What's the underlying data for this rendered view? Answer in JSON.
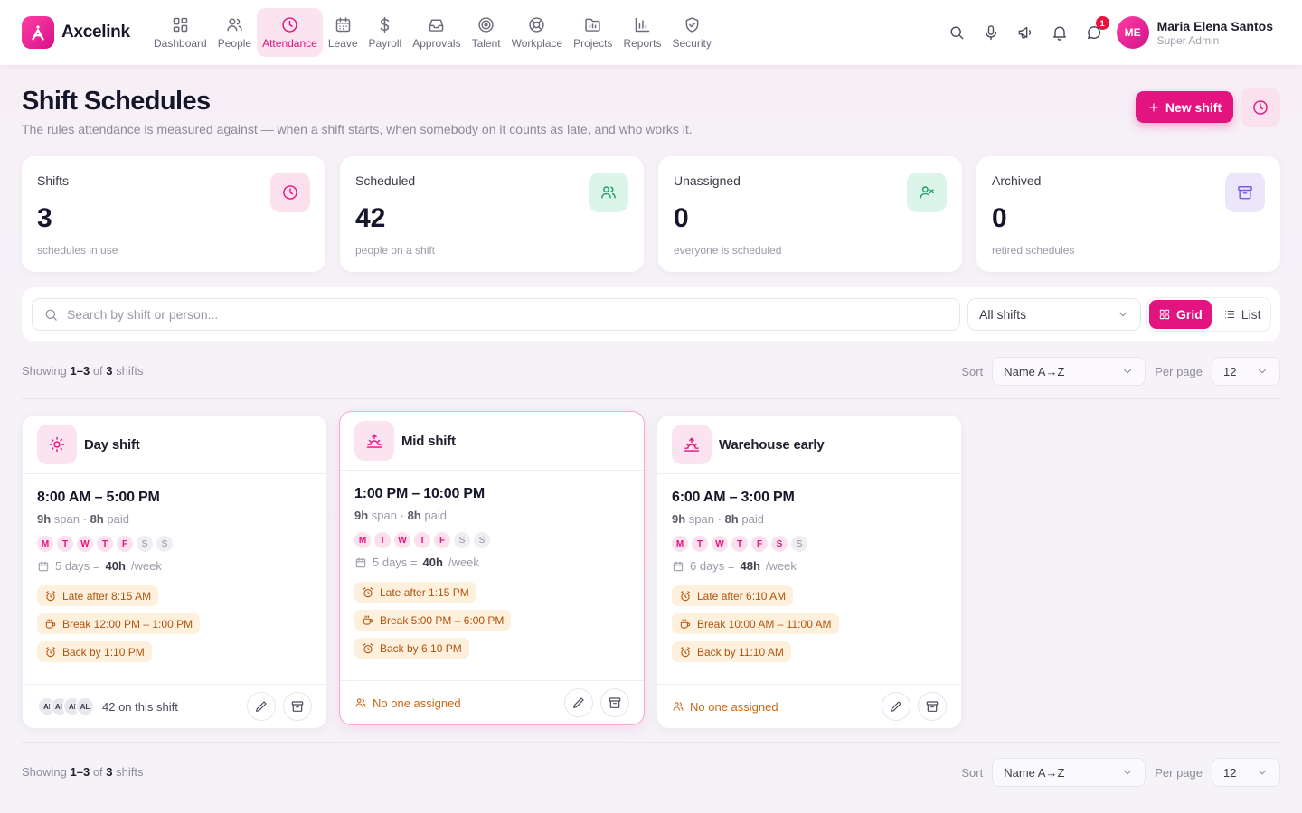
{
  "brand": {
    "name": "Axcelink"
  },
  "nav": [
    {
      "label": "Dashboard",
      "icon": "dashboard-icon"
    },
    {
      "label": "People",
      "icon": "people-icon"
    },
    {
      "label": "Attendance",
      "icon": "clock-icon"
    },
    {
      "label": "Leave",
      "icon": "calendar-icon"
    },
    {
      "label": "Payroll",
      "icon": "dollar-icon"
    },
    {
      "label": "Approvals",
      "icon": "inbox-icon"
    },
    {
      "label": "Talent",
      "icon": "target-icon"
    },
    {
      "label": "Workplace",
      "icon": "lifebuoy-icon"
    },
    {
      "label": "Projects",
      "icon": "folder-icon"
    },
    {
      "label": "Reports",
      "icon": "bar-chart-icon"
    },
    {
      "label": "Security",
      "icon": "shield-icon"
    }
  ],
  "header": {
    "chat_badge": "1",
    "user": {
      "initials": "ME",
      "name": "Maria Elena Santos",
      "role": "Super Admin"
    }
  },
  "page": {
    "title": "Shift Schedules",
    "subtitle": "The rules attendance is measured against — when a shift starts, when somebody on it counts as late, and who works it.",
    "new_button": "New shift"
  },
  "stats": [
    {
      "label": "Shifts",
      "value": "3",
      "hint": "schedules in use",
      "icon": "clock-icon",
      "bg": "#fbe1ee",
      "fg": "#e3137f"
    },
    {
      "label": "Scheduled",
      "value": "42",
      "hint": "people on a shift",
      "icon": "users-icon",
      "bg": "#dcf5ea",
      "fg": "#1f9d63"
    },
    {
      "label": "Unassigned",
      "value": "0",
      "hint": "everyone is scheduled",
      "icon": "user-x-icon",
      "bg": "#dcf5ea",
      "fg": "#1f9d63"
    },
    {
      "label": "Archived",
      "value": "0",
      "hint": "retired schedules",
      "icon": "archive-icon",
      "bg": "#ece6fb",
      "fg": "#7c5ad9"
    }
  ],
  "filters": {
    "search_placeholder": "Search by shift or person...",
    "shift_filter": "All shifts",
    "view_grid": "Grid",
    "view_list": "List"
  },
  "pagination": {
    "showing_prefix": "Showing",
    "range": "1–3",
    "of": "of",
    "total": "3",
    "noun": "shifts",
    "sort_label": "Sort",
    "sort_value": "Name A→Z",
    "per_page_label": "Per page",
    "per_page_value": "12"
  },
  "shifts": [
    {
      "name": "Day shift",
      "icon": "sun-icon",
      "time": "8:00 AM – 5:00 PM",
      "span_hours": "9h",
      "span_label": "span",
      "paid_hours": "8h",
      "paid_label": "paid",
      "days": [
        "M",
        "T",
        "W",
        "T",
        "F",
        "S",
        "S"
      ],
      "days_on": [
        true,
        true,
        true,
        true,
        true,
        false,
        false
      ],
      "days_count": "5 days =",
      "weekly": "40h",
      "weekly_unit": "/week",
      "late": "Late after 8:15 AM",
      "break": "Break 12:00 PM – 1:00 PM",
      "back": "Back by 1:10 PM",
      "assigned_avatars": [
        "AI",
        "AII",
        "AI",
        "AL"
      ],
      "assigned_text": "42 on this shift"
    },
    {
      "name": "Mid shift",
      "icon": "sunrise-icon",
      "time": "1:00 PM – 10:00 PM",
      "span_hours": "9h",
      "span_label": "span",
      "paid_hours": "8h",
      "paid_label": "paid",
      "days": [
        "M",
        "T",
        "W",
        "T",
        "F",
        "S",
        "S"
      ],
      "days_on": [
        true,
        true,
        true,
        true,
        true,
        false,
        false
      ],
      "days_count": "5 days =",
      "weekly": "40h",
      "weekly_unit": "/week",
      "late": "Late after 1:15 PM",
      "break": "Break 5:00 PM – 6:00 PM",
      "back": "Back by 6:10 PM",
      "assigned_text": "No one assigned"
    },
    {
      "name": "Warehouse early",
      "icon": "sunrise-icon",
      "time": "6:00 AM – 3:00 PM",
      "span_hours": "9h",
      "span_label": "span",
      "paid_hours": "8h",
      "paid_label": "paid",
      "days": [
        "M",
        "T",
        "W",
        "T",
        "F",
        "S",
        "S"
      ],
      "days_on": [
        true,
        true,
        true,
        true,
        true,
        true,
        false
      ],
      "days_count": "6 days =",
      "weekly": "48h",
      "weekly_unit": "/week",
      "late": "Late after 6:10 AM",
      "break": "Break 10:00 AM – 11:00 AM",
      "back": "Back by 11:10 AM",
      "assigned_text": "No one assigned"
    }
  ]
}
